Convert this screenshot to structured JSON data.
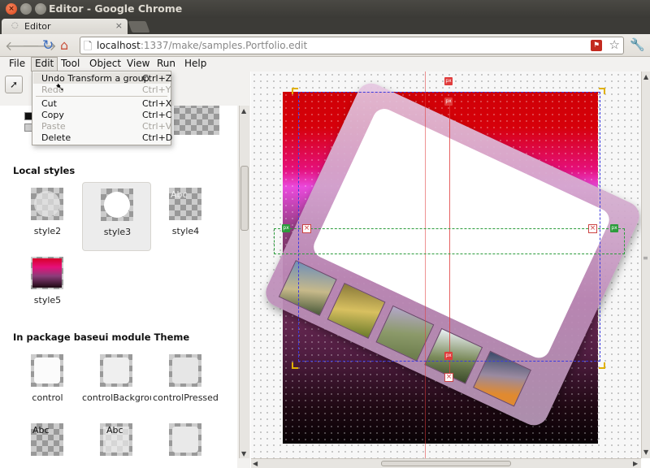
{
  "window": {
    "title": "Editor - Google Chrome"
  },
  "tab": {
    "label": "Editor",
    "close_glyph": "×"
  },
  "browser": {
    "url_host": "localhost",
    "url_rest": ":1337/make/samples.Portfolio.edit"
  },
  "menubar": {
    "items": [
      "File",
      "Edit",
      "Tool",
      "Object",
      "View",
      "Run",
      "Help"
    ]
  },
  "edit_menu": {
    "items": [
      {
        "label": "Undo Transform a group",
        "shortcut": "Ctrl+Z",
        "enabled": true
      },
      {
        "label": "Redo",
        "shortcut": "Ctrl+Y",
        "enabled": false
      },
      {
        "label": "Cut",
        "shortcut": "Ctrl+X",
        "enabled": true
      },
      {
        "label": "Copy",
        "shortcut": "Ctrl+C",
        "enabled": true
      },
      {
        "label": "Paste",
        "shortcut": "Ctrl+V",
        "enabled": false
      },
      {
        "label": "Delete",
        "shortcut": "Ctrl+D",
        "enabled": true
      }
    ]
  },
  "left_panel": {
    "local_styles_title": "Local styles",
    "local_styles": [
      {
        "name": "style2"
      },
      {
        "name": "style3",
        "selected": true
      },
      {
        "name": "style4",
        "text": "Abc"
      },
      {
        "name": "style5"
      }
    ],
    "package_title": "In package baseui module Theme",
    "package_styles": [
      {
        "name": "control"
      },
      {
        "name": "controlBackground"
      },
      {
        "name": "controlPressed"
      },
      {
        "name": "",
        "text": "Abc"
      },
      {
        "name": "",
        "text": "Abc"
      },
      {
        "name": ""
      }
    ]
  },
  "canvas": {
    "handle_badge_text": "px",
    "delete_glyph": "×",
    "colors": {
      "guide_red": "#e03b3b",
      "guide_green": "#2c9c3c",
      "guide_blue": "#3a3ae0",
      "handle_yellow": "#e0b000"
    }
  },
  "icons": {
    "back": "arrow-left-icon",
    "forward": "arrow-right-icon",
    "reload": "reload-icon",
    "home": "home-icon",
    "star": "star-icon",
    "wrench": "wrench-icon",
    "select": "pointer-icon"
  }
}
